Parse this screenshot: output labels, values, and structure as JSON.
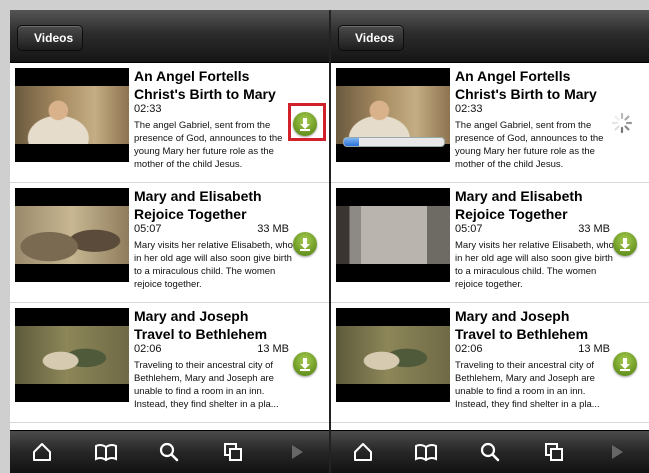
{
  "nav": {
    "back_label": "Videos"
  },
  "colors": {
    "download_green": "#6c9a25",
    "highlight_red": "#d0202a",
    "progress_blue": "#2b72d8"
  },
  "screens": [
    {
      "items": [
        {
          "title": "An Angel Fortells Christ's Birth to Mary",
          "duration": "02:33",
          "size": "",
          "description": "The angel Gabriel, sent from the presence of God, announces to the young Mary her future role as the mother of the child Jesus.",
          "state": "download",
          "highlighted": true,
          "download_icon": "download-arrow-icon"
        },
        {
          "title": "Mary and Elisabeth Rejoice Together",
          "duration": "05:07",
          "size": "33 MB",
          "description": "Mary visits her relative Elisabeth, who in her old age will also soon give birth to a miraculous child. The women rejoice together.",
          "state": "download",
          "download_icon": "download-arrow-icon"
        },
        {
          "title": "Mary and Joseph Travel to Bethlehem",
          "duration": "02:06",
          "size": "13 MB",
          "description": "Traveling to their ancestral city of Bethlehem, Mary and Joseph are unable to find a room in an inn. Instead, they find shelter in a pla...",
          "state": "download",
          "download_icon": "download-arrow-icon"
        }
      ]
    },
    {
      "items": [
        {
          "title": "An Angel Fortells Christ's Birth to Mary",
          "duration": "02:33",
          "size": "",
          "description": "The angel Gabriel, sent from the presence of God, announces to the young Mary her future role as the mother of the child Jesus.",
          "state": "downloading",
          "progress": 0.15,
          "spinner_icon": "loading-spinner-icon"
        },
        {
          "title": "Mary and Elisabeth Rejoice Together",
          "duration": "05:07",
          "size": "33 MB",
          "description": "Mary visits her relative Elisabeth, who in her old age will also soon give birth to a miraculous child. The women rejoice together.",
          "state": "download",
          "download_icon": "download-arrow-icon"
        },
        {
          "title": "Mary and Joseph Travel to Bethlehem",
          "duration": "02:06",
          "size": "13 MB",
          "description": "Traveling to their ancestral city of Bethlehem, Mary and Joseph are unable to find a room in an inn. Instead, they find shelter in a pla...",
          "state": "download",
          "download_icon": "download-arrow-icon"
        }
      ]
    }
  ],
  "tabbar": {
    "icons": [
      "home-icon",
      "book-icon",
      "search-icon",
      "copy-icon",
      "play-icon"
    ]
  }
}
